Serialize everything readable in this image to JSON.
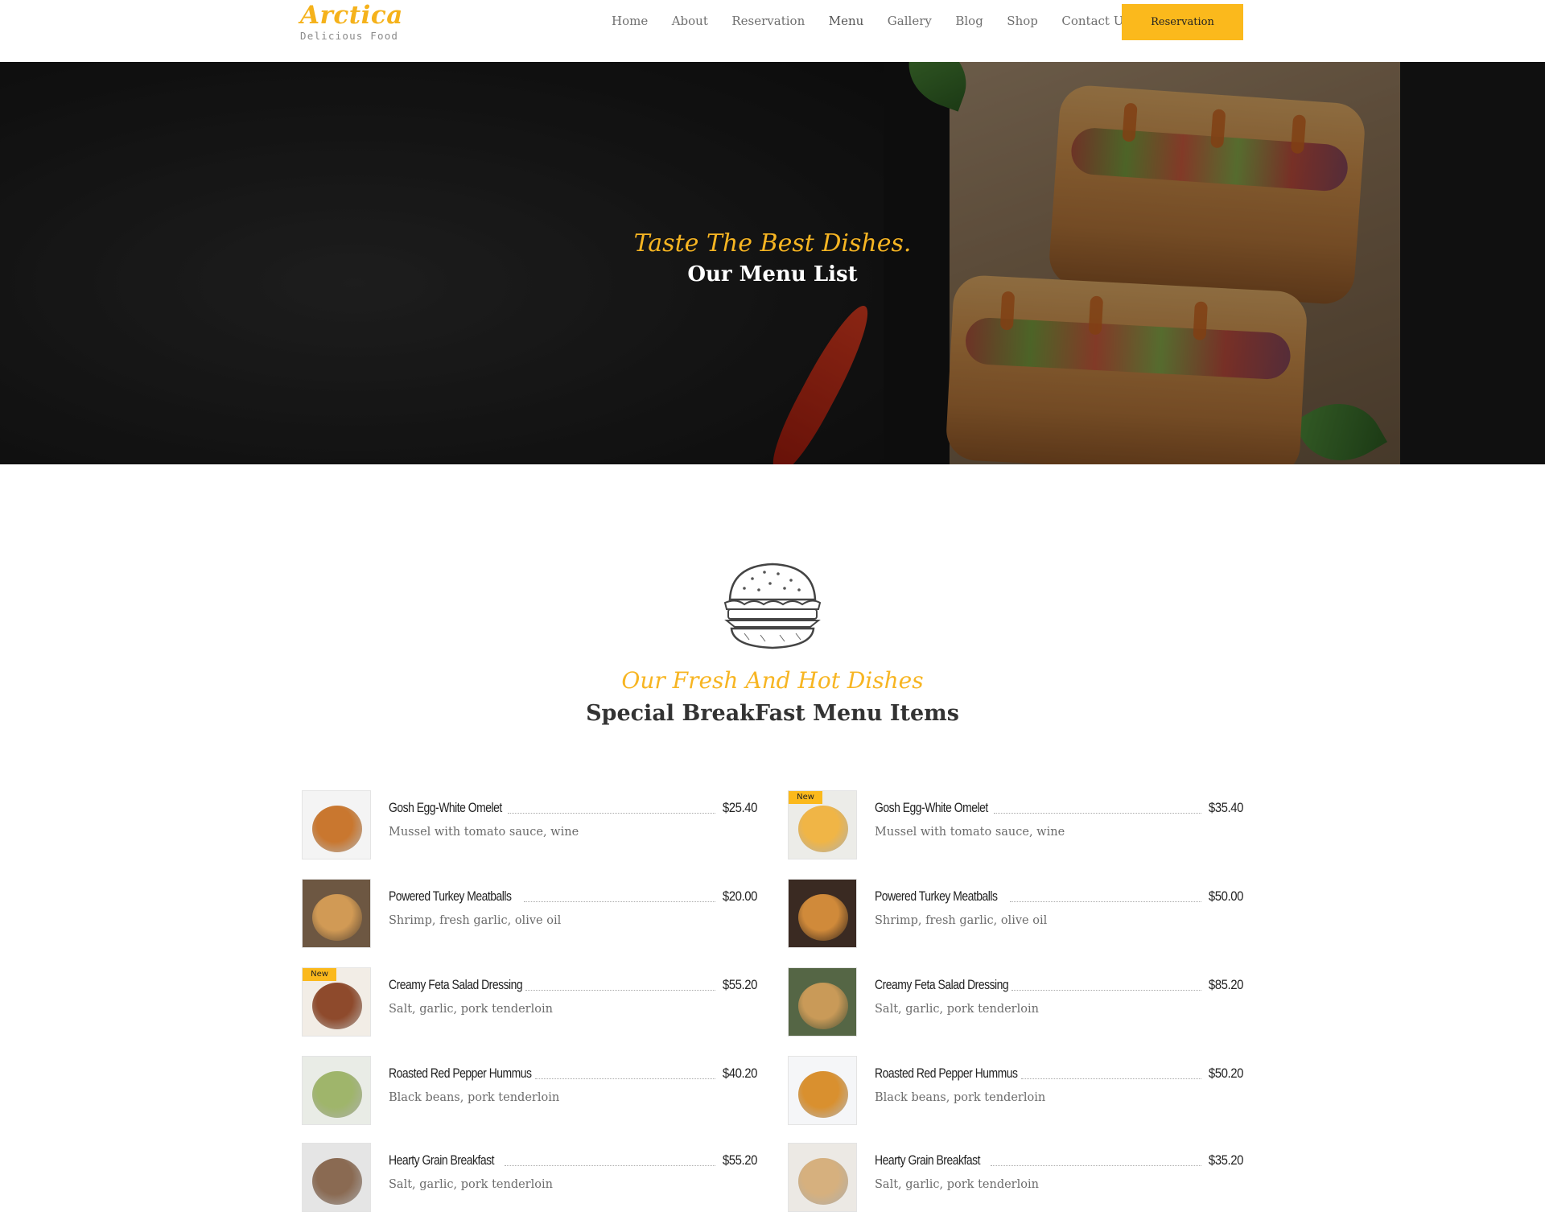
{
  "brand": {
    "name": "Arctica",
    "tagline": "Delicious Food",
    "accent": "#fbb91c"
  },
  "nav": {
    "items": [
      "Home",
      "About",
      "Reservation",
      "Menu",
      "Gallery",
      "Blog",
      "Shop",
      "Contact Us"
    ],
    "cta": "Reservation"
  },
  "hero": {
    "subtitle": "Taste The Best Dishes.",
    "title": "Our Menu List"
  },
  "section": {
    "icon": "burger-icon",
    "subtitle": "Our Fresh And Hot Dishes",
    "title": "Special BreakFast Menu Items"
  },
  "menu": {
    "left": [
      {
        "name": "Gosh Egg-White Omelet",
        "price": "$25.40",
        "desc": "Mussel with tomato sauce, wine",
        "badge": ""
      },
      {
        "name": "Powered Turkey Meatballs",
        "price": "$20.00",
        "desc": "Shrimp, fresh garlic, olive oil",
        "badge": ""
      },
      {
        "name": "Creamy Feta Salad Dressing",
        "price": "$55.20",
        "desc": "Salt, garlic, pork tenderloin",
        "badge": "New"
      },
      {
        "name": "Roasted Red Pepper Hummus",
        "price": "$40.20",
        "desc": "Black beans, pork tenderloin",
        "badge": ""
      },
      {
        "name": "Hearty Grain Breakfast",
        "price": "$55.20",
        "desc": "Salt, garlic, pork tenderloin",
        "badge": ""
      }
    ],
    "right": [
      {
        "name": "Gosh Egg-White Omelet",
        "price": "$35.40",
        "desc": "Mussel with tomato sauce, wine",
        "badge": "New"
      },
      {
        "name": "Powered Turkey Meatballs",
        "price": "$50.00",
        "desc": "Shrimp, fresh garlic, olive oil",
        "badge": ""
      },
      {
        "name": "Creamy Feta Salad Dressing",
        "price": "$85.20",
        "desc": "Salt, garlic, pork tenderloin",
        "badge": ""
      },
      {
        "name": "Roasted Red Pepper Hummus",
        "price": "$50.20",
        "desc": "Black beans, pork tenderloin",
        "badge": ""
      },
      {
        "name": "Hearty Grain Breakfast",
        "price": "$35.20",
        "desc": "Salt, garlic, pork tenderloin",
        "badge": ""
      }
    ]
  }
}
